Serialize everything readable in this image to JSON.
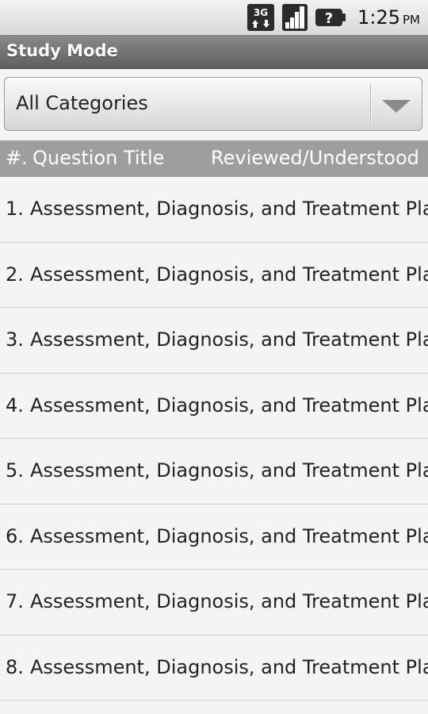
{
  "status_bar": {
    "network": "3G",
    "time": "1:25",
    "ampm": "PM"
  },
  "title_bar": {
    "title": "Study Mode"
  },
  "category_spinner": {
    "selected": "All Categories"
  },
  "list_header": {
    "number": "#.",
    "question_title": "Question Title",
    "reviewed": "Reviewed/Understood"
  },
  "questions": [
    {
      "number": "1.",
      "title": "Assessment, Diagnosis, and Treatment Pla"
    },
    {
      "number": "2.",
      "title": "Assessment, Diagnosis, and Treatment Pla"
    },
    {
      "number": "3.",
      "title": "Assessment, Diagnosis, and Treatment Pla"
    },
    {
      "number": "4.",
      "title": "Assessment, Diagnosis, and Treatment Pla"
    },
    {
      "number": "5.",
      "title": "Assessment, Diagnosis, and Treatment Pla"
    },
    {
      "number": "6.",
      "title": "Assessment, Diagnosis, and Treatment Pla"
    },
    {
      "number": "7.",
      "title": "Assessment, Diagnosis, and Treatment Pla"
    },
    {
      "number": "8.",
      "title": "Assessment, Diagnosis, and Treatment Pla"
    }
  ]
}
